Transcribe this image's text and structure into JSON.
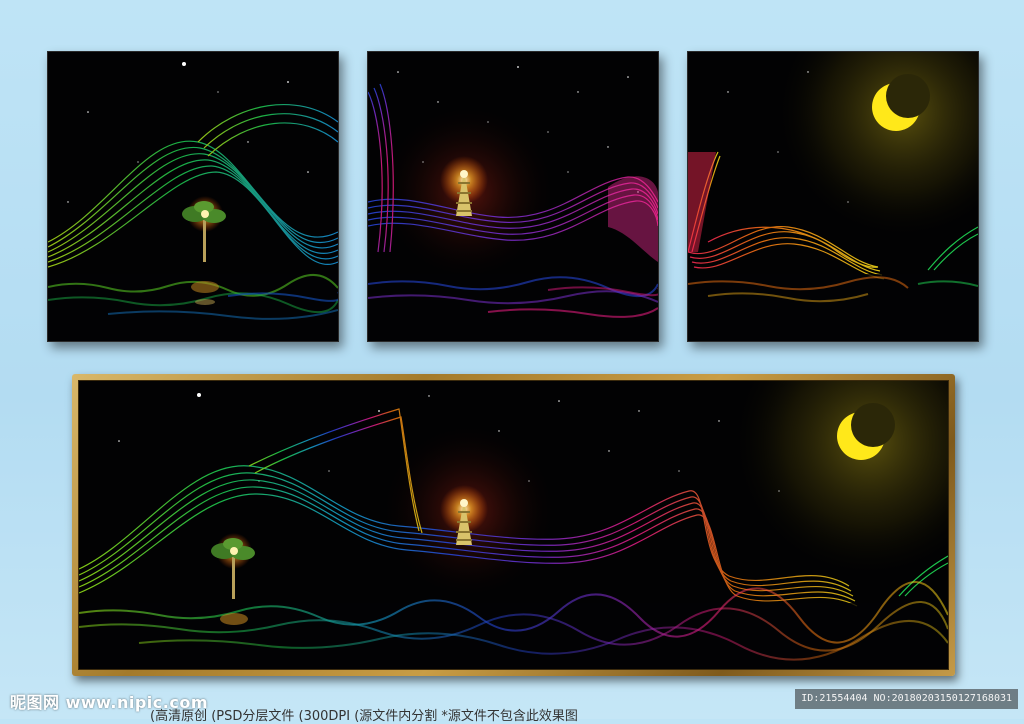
{
  "watermark": {
    "text": "昵图网 www.nipic.com"
  },
  "id_bar": {
    "text": "ID:21554404 NO:20180203150127168031"
  },
  "caption": {
    "text": "(高清原创 (PSD分层文件 (300DPI (源文件内分割 *源文件不包含此效果图"
  },
  "colors": {
    "background": "#bfe4f6",
    "frame_gold": "#c49a48",
    "canvas_black": "#020203",
    "moon_yellow": "#ffe81a"
  },
  "icons": [
    "moon-icon",
    "pagoda-icon",
    "tree-icon",
    "star-icon"
  ]
}
